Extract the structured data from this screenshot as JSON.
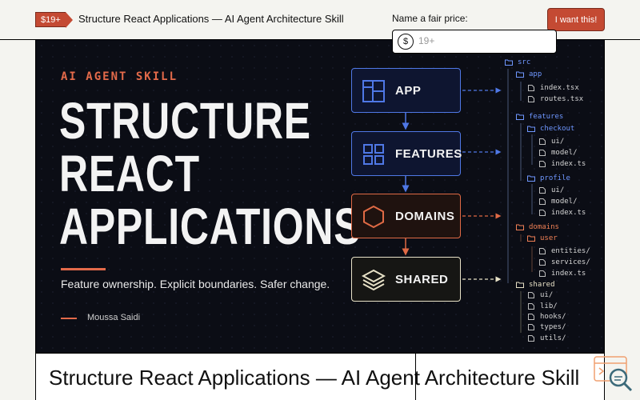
{
  "header": {
    "price_badge": "$19+",
    "title": "Structure React Applications — AI Agent Architecture Skill",
    "cta": "I want this!"
  },
  "cover": {
    "eyebrow": "AI AGENT SKILL",
    "title_lines": [
      "STRUCTURE",
      "REACT",
      "APPLICATIONS"
    ],
    "tagline": "Feature ownership. Explicit boundaries. Safer change.",
    "author": "Moussa Saidi",
    "layers": [
      "APP",
      "FEATURES",
      "DOMAINS",
      "SHARED"
    ],
    "colors": {
      "blue": "#4f78e6",
      "orange": "#e06a45",
      "cream": "#e8e2c8",
      "background": "#0b0d15"
    },
    "tree": [
      {
        "label": "src",
        "kind": "folder",
        "color": "blue"
      },
      {
        "label": "app",
        "kind": "folder",
        "color": "blue"
      },
      {
        "label": "index.tsx",
        "kind": "file"
      },
      {
        "label": "routes.tsx",
        "kind": "file"
      },
      {
        "label": "features",
        "kind": "folder",
        "color": "blue"
      },
      {
        "label": "checkout",
        "kind": "folder",
        "color": "blue"
      },
      {
        "label": "ui/",
        "kind": "file"
      },
      {
        "label": "model/",
        "kind": "file"
      },
      {
        "label": "index.ts",
        "kind": "file"
      },
      {
        "label": "profile",
        "kind": "folder",
        "color": "blue"
      },
      {
        "label": "ui/",
        "kind": "file"
      },
      {
        "label": "model/",
        "kind": "file"
      },
      {
        "label": "index.ts",
        "kind": "file"
      },
      {
        "label": "domains",
        "kind": "folder",
        "color": "orange"
      },
      {
        "label": "user",
        "kind": "folder",
        "color": "orange"
      },
      {
        "label": "entities/",
        "kind": "file"
      },
      {
        "label": "services/",
        "kind": "file"
      },
      {
        "label": "index.ts",
        "kind": "file"
      },
      {
        "label": "shared",
        "kind": "folder",
        "color": "cream"
      },
      {
        "label": "ui/",
        "kind": "file"
      },
      {
        "label": "lib/",
        "kind": "file"
      },
      {
        "label": "hooks/",
        "kind": "file"
      },
      {
        "label": "types/",
        "kind": "file"
      },
      {
        "label": "utils/",
        "kind": "file"
      }
    ]
  },
  "product": {
    "title": "Structure React Applications — AI Agent Architecture Skill"
  },
  "pricing": {
    "label": "Name a fair price:",
    "currency": "$",
    "placeholder": "19+"
  }
}
